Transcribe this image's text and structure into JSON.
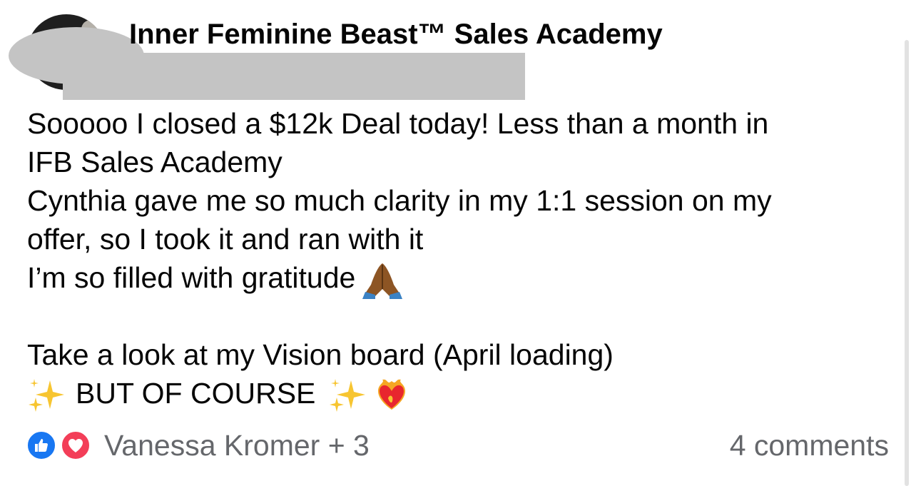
{
  "post": {
    "group_name": "Inner Feminine Beast™ Sales Academy",
    "lines": [
      "Sooooo I closed a $12k Deal today! Less than a month in",
      "IFB Sales Academy",
      "Cynthia gave me so much clarity in my 1:1 session on my",
      "offer, so I took it and ran with it",
      "I’m so filled with gratitude",
      "Take a look at my Vision board (April loading)",
      "BUT OF COURSE"
    ],
    "emojis": {
      "gratitude": "folded-hands-emoji",
      "sparkles": "sparkles-emoji",
      "heart_on_fire": "heart-on-fire-emoji"
    }
  },
  "footer": {
    "reactions": [
      "like-reaction-icon",
      "love-reaction-icon"
    ],
    "reactors_text": "Vanessa Kromer + 3",
    "comments_text": "4 comments"
  },
  "colors": {
    "text": "#050505",
    "muted": "#65676b",
    "like_blue": "#1877f2",
    "love_red": "#f33e58",
    "redaction_gray": "#c4c4c4"
  }
}
